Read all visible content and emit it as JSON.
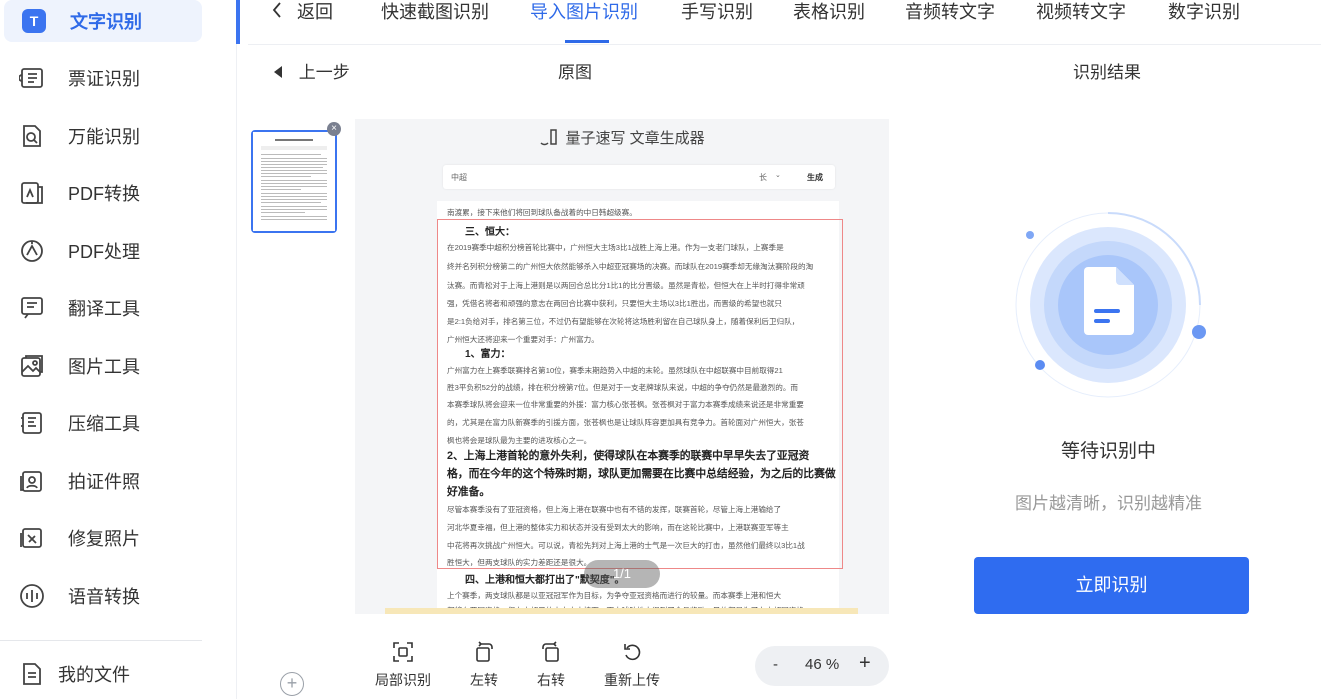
{
  "sidebar": {
    "active": {
      "label": "文字识别",
      "icon": "T"
    },
    "items": [
      {
        "label": "票证识别",
        "icon": "ticket-icon"
      },
      {
        "label": "万能识别",
        "icon": "scan-file-icon"
      },
      {
        "label": "PDF转换",
        "icon": "pdf-convert-icon"
      },
      {
        "label": "PDF处理",
        "icon": "pdf-process-icon"
      },
      {
        "label": "翻译工具",
        "icon": "translate-icon"
      },
      {
        "label": "图片工具",
        "icon": "image-tool-icon"
      },
      {
        "label": "压缩工具",
        "icon": "compress-icon"
      },
      {
        "label": "拍证件照",
        "icon": "id-photo-icon"
      },
      {
        "label": "修复照片",
        "icon": "repair-photo-icon"
      },
      {
        "label": "语音转换",
        "icon": "voice-icon"
      }
    ],
    "my_files": "我的文件"
  },
  "topbar": {
    "back": "返回",
    "tabs": [
      "快速截图识别",
      "导入图片识别",
      "手写识别",
      "表格识别",
      "音频转文字",
      "视频转文字",
      "数字识别"
    ],
    "active_tab": "导入图片识别"
  },
  "subheader": {
    "prev_step": "上一步",
    "original": "原图",
    "result": "识别结果"
  },
  "preview": {
    "app_title": "量子速写 文章生成器",
    "input_text": "中超",
    "length_select": "长",
    "generate_label": "生成",
    "page_indicator": "1/1",
    "doc": {
      "intro": "南渡累，接下来他们将回到球队备战着的中日韩超级赛。",
      "h3": "三、恒大：",
      "p1": [
        "在2019赛季中超积分榜首轮比赛中，广州恒大主场3比1战胜上海上港。作为一支老门球队，上赛季是",
        "终并名列积分榜第二的广州恒大依然能够杀入中超亚冠赛场的决赛。而球队在2019赛季却无缘淘汰赛阶段的淘",
        "汰赛。而青松对于上海上港则是以两回合总比分1比1的比分晋级。虽然是青松，但恒大在上半时打得非常顽",
        "强，凭借名将者和顽强的意志在两回合比赛中获利，只要恒大主场以3比1胜出，而晋级的希望也就只",
        "是2:1负给对手，排名第三位，不过仍有望能够在次轮将这场胜利留在自己球队身上，随着保利后卫归队，",
        "广州恒大还将迎来一个重要对手：广州富力。"
      ],
      "h1": "1、富力：",
      "p2": [
        "广州富力在上赛季联赛排名第10位，赛季末期趋势入中超的末轮。虽然球队在中超联赛中目前取得21",
        "胜3平负积52分的战绩，排在积分榜第7位。但是对于一支老牌球队来说，中超的争夺仍然是最激烈的。而",
        "本赛季球队将会迎来一位非常重要的外援：富力核心张苍枫。张苍枫对于富力本赛季成绩来说还是非常重要",
        "的，尤其是在富力队新赛季的引援方面，张苍枫也是让球队阵容更加具有竞争力。首轮面对广州恒大，张苍",
        "枫也将会是球队最为主要的进攻核心之一。"
      ],
      "h2": "2、上海上港首轮的意外失利，使得球队在本赛季的联赛中早早失去了亚冠资格，而在今年的这个特殊时期，球队更加需要在比赛中总结经验，为之后的比赛做好准备。",
      "h2_lines": [
        "2、上海上港首轮的意外失利，使得球队在本赛季的联赛中早早失去了亚冠资",
        "格，而在今年的这个特殊时期，球队更加需要在比赛中总结经验，为之后的比赛做",
        "好准备。"
      ],
      "p3": [
        "尽管本赛季没有了亚冠资格，但上海上港在联赛中也有不错的发挥，联赛首轮，尽管上海上港输给了",
        "河北华夏幸福，但上港的整体实力和状态并没有受到太大的影响，而在这轮比赛中，上港联赛亚军等主",
        "中花将再次挑战广州恒大。可以说，青松先判对上海上港的士气是一次巨大的打击，虽然他们最终以3比1战",
        "胜恒大，但两支球队的实力差距还是很大。"
      ],
      "h4": "四、上港和恒大都打出了\"默契度\"。",
      "p4": [
        "上个赛季，两支球队都是以亚冠冠军作为目标，为争夺亚冠资格而进行的较量。而本赛季上港和恒大",
        "都将在亚冠资格，但在中超目的中大大支持下，而去球队地去得到了全具奖励，目的都是为了在中超冠资格"
      ]
    }
  },
  "tools": [
    {
      "label": "局部识别",
      "icon": "partial-recognize-icon"
    },
    {
      "label": "左转",
      "icon": "rotate-left-icon"
    },
    {
      "label": "右转",
      "icon": "rotate-right-icon"
    },
    {
      "label": "重新上传",
      "icon": "reupload-icon"
    }
  ],
  "zoom": {
    "minus": "-",
    "value": "46 %",
    "plus": "+"
  },
  "result": {
    "status": "等待识别中",
    "hint": "图片越清晰，识别越精准",
    "button": "立即识别"
  },
  "colors": {
    "accent": "#2f6ae8",
    "button": "#2f6cf0",
    "active_bg": "#eef3fd"
  }
}
